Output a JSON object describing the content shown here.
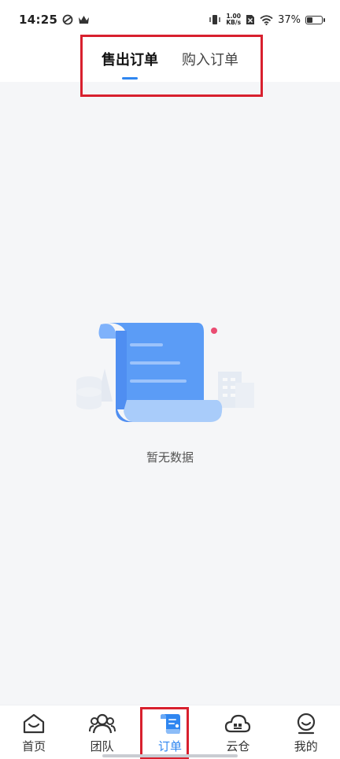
{
  "status_bar": {
    "time": "14:25",
    "speed_value": "1.00",
    "speed_unit": "KB/s",
    "battery": "37%",
    "battery_level": 0.37
  },
  "tabs": [
    {
      "label": "售出订单",
      "active": true
    },
    {
      "label": "购入订单",
      "active": false
    }
  ],
  "empty_state": {
    "text": "暂无数据",
    "icon": "empty-scroll-illustration"
  },
  "bottom_nav": [
    {
      "label": "首页",
      "icon": "home-icon",
      "active": false
    },
    {
      "label": "团队",
      "icon": "team-icon",
      "active": false
    },
    {
      "label": "订单",
      "icon": "order-icon",
      "active": true
    },
    {
      "label": "云仓",
      "icon": "cloud-warehouse-icon",
      "active": false
    },
    {
      "label": "我的",
      "icon": "profile-icon",
      "active": false
    }
  ],
  "colors": {
    "accent": "#2f86f0",
    "highlight_box": "#d8202e",
    "background": "#f5f6f8"
  }
}
